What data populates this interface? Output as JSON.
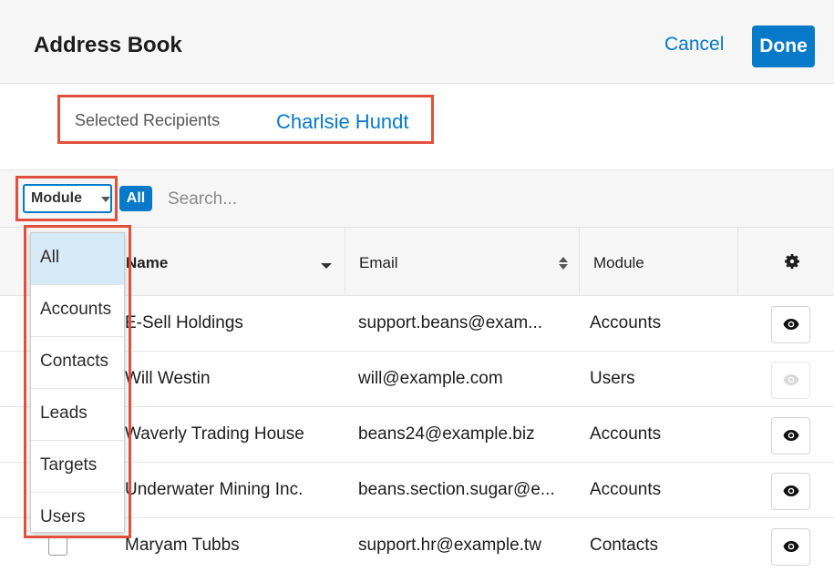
{
  "header": {
    "title": "Address Book",
    "cancel_label": "Cancel",
    "done_label": "Done"
  },
  "recipients": {
    "label": "Selected Recipients",
    "value": "Charlsie Hundt"
  },
  "filter": {
    "module_label": "Module",
    "all_label": "All",
    "search_placeholder": "Search..."
  },
  "dropdown": {
    "items": [
      {
        "label": "All",
        "active": true
      },
      {
        "label": "Accounts"
      },
      {
        "label": "Contacts"
      },
      {
        "label": "Leads"
      },
      {
        "label": "Targets"
      },
      {
        "label": "Users"
      }
    ]
  },
  "table": {
    "columns": {
      "name": "Name",
      "email": "Email",
      "module": "Module"
    },
    "rows": [
      {
        "name": "E-Sell Holdings",
        "email": "support.beans@exam...",
        "module": "Accounts",
        "preview_enabled": true
      },
      {
        "name": "Will Westin",
        "email": "will@example.com",
        "module": "Users",
        "preview_enabled": false
      },
      {
        "name": "Waverly Trading House",
        "email": "beans24@example.biz",
        "module": "Accounts",
        "preview_enabled": true
      },
      {
        "name": "Underwater Mining Inc.",
        "email": "beans.section.sugar@e...",
        "module": "Accounts",
        "preview_enabled": true
      },
      {
        "name": "Maryam Tubbs",
        "email": "support.hr@example.tw",
        "module": "Contacts",
        "preview_enabled": true
      }
    ]
  },
  "colors": {
    "accent": "#0679c8",
    "highlight": "#e0503c"
  }
}
